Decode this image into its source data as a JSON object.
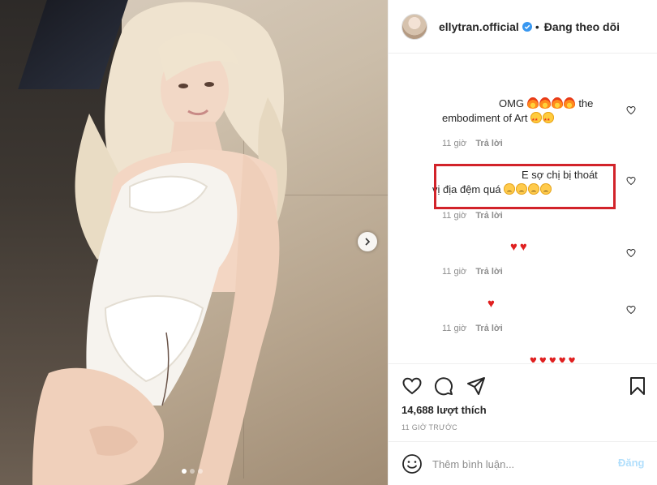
{
  "header": {
    "username": "ellytran.official",
    "separator": "•",
    "follow_label": "Đang theo dõi"
  },
  "comments": [
    {
      "text": "OMG",
      "emojis": [
        "fire-emoji",
        "fire-emoji",
        "fire-emoji",
        "fire-emoji"
      ],
      "text_after": "the embodiment of Art",
      "trailing_emojis": [
        "star-struck-emoji",
        "star-struck-emoji"
      ],
      "time": "11 giờ",
      "reply_label": "Trả lời"
    },
    {
      "text": "E sợ chị bị thoát vị địa đệm quá",
      "trailing_emojis": [
        "sad-face-emoji",
        "sad-face-emoji",
        "sad-face-emoji",
        "sad-face-emoji"
      ],
      "time": "11 giờ",
      "reply_label": "Trả lời",
      "highlighted": true
    },
    {
      "text": "",
      "trailing_emojis": [
        "heart-emoji",
        "heart-emoji"
      ],
      "time": "11 giờ",
      "reply_label": "Trả lời"
    },
    {
      "text": "",
      "trailing_emojis": [
        "heart-emoji"
      ],
      "time": "11 giờ",
      "reply_label": "Trả lời"
    },
    {
      "text": "",
      "trailing_emojis": [
        "heart-emoji",
        "heart-emoji",
        "heart-emoji",
        "heart-emoji",
        "heart-emoji"
      ]
    }
  ],
  "actions": {
    "likes": "14,688 lượt thích",
    "time_ago": "11 GIỜ TRƯỚC"
  },
  "add_comment": {
    "placeholder": "Thêm bình luận...",
    "post_label": "Đăng"
  },
  "carousel": {
    "slide_count": 3,
    "active_slide": 1
  },
  "colors": {
    "highlight": "#d2232a",
    "verified": "#3897f0",
    "muted": "#8e8e8e",
    "post_disabled": "#b2dffc"
  }
}
